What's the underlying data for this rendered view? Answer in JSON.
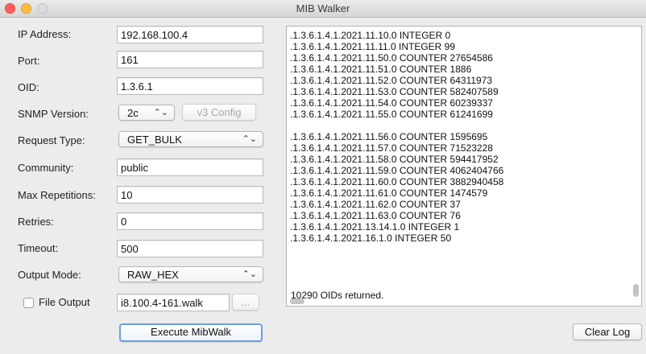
{
  "window": {
    "title": "MIB Walker"
  },
  "form": {
    "ip_address": {
      "label": "IP Address:",
      "value": "192.168.100.4"
    },
    "port": {
      "label": "Port:",
      "value": "161"
    },
    "oid": {
      "label": "OID:",
      "value": "1.3.6.1"
    },
    "snmp_version": {
      "label": "SNMP Version:",
      "value": "2c",
      "v3_config_label": "v3 Config"
    },
    "request_type": {
      "label": "Request Type:",
      "value": "GET_BULK"
    },
    "community": {
      "label": "Community:",
      "value": "public"
    },
    "max_repetitions": {
      "label": "Max Repetitions:",
      "value": "10"
    },
    "retries": {
      "label": "Retries:",
      "value": "0"
    },
    "timeout": {
      "label": "Timeout:",
      "value": "500"
    },
    "output_mode": {
      "label": "Output Mode:",
      "value": "RAW_HEX"
    },
    "file_output": {
      "label": "File Output",
      "checked": false,
      "filename": "i8.100.4-161.walk",
      "browse_label": "..."
    },
    "execute_label": "Execute MibWalk"
  },
  "log": {
    "lines": [
      ".1.3.6.1.4.1.2021.11.10.0 INTEGER 0",
      ".1.3.6.1.4.1.2021.11.11.0 INTEGER 99",
      ".1.3.6.1.4.1.2021.11.50.0 COUNTER 27654586",
      ".1.3.6.1.4.1.2021.11.51.0 COUNTER 1886",
      ".1.3.6.1.4.1.2021.11.52.0 COUNTER 64311973",
      ".1.3.6.1.4.1.2021.11.53.0 COUNTER 582407589",
      ".1.3.6.1.4.1.2021.11.54.0 COUNTER 60239337",
      ".1.3.6.1.4.1.2021.11.55.0 COUNTER 61241699",
      ".1.3.6.1.4.1.2021.11.56.0 COUNTER 1595695",
      ".1.3.6.1.4.1.2021.11.57.0 COUNTER 71523228",
      ".1.3.6.1.4.1.2021.11.58.0 COUNTER 594417952",
      ".1.3.6.1.4.1.2021.11.59.0 COUNTER 4062404766",
      ".1.3.6.1.4.1.2021.11.60.0 COUNTER 3882940458",
      ".1.3.6.1.4.1.2021.11.61.0 COUNTER 1474579",
      ".1.3.6.1.4.1.2021.11.62.0 COUNTER 37",
      ".1.3.6.1.4.1.2021.11.63.0 COUNTER 76",
      ".1.3.6.1.4.1.2021.13.14.1.0 INTEGER 1",
      ".1.3.6.1.4.1.2021.16.1.0 INTEGER 50"
    ],
    "summary": "10290 OIDs returned.",
    "clear_label": "Clear Log"
  },
  "icons": {
    "select_arrows": "⌃⌄"
  }
}
